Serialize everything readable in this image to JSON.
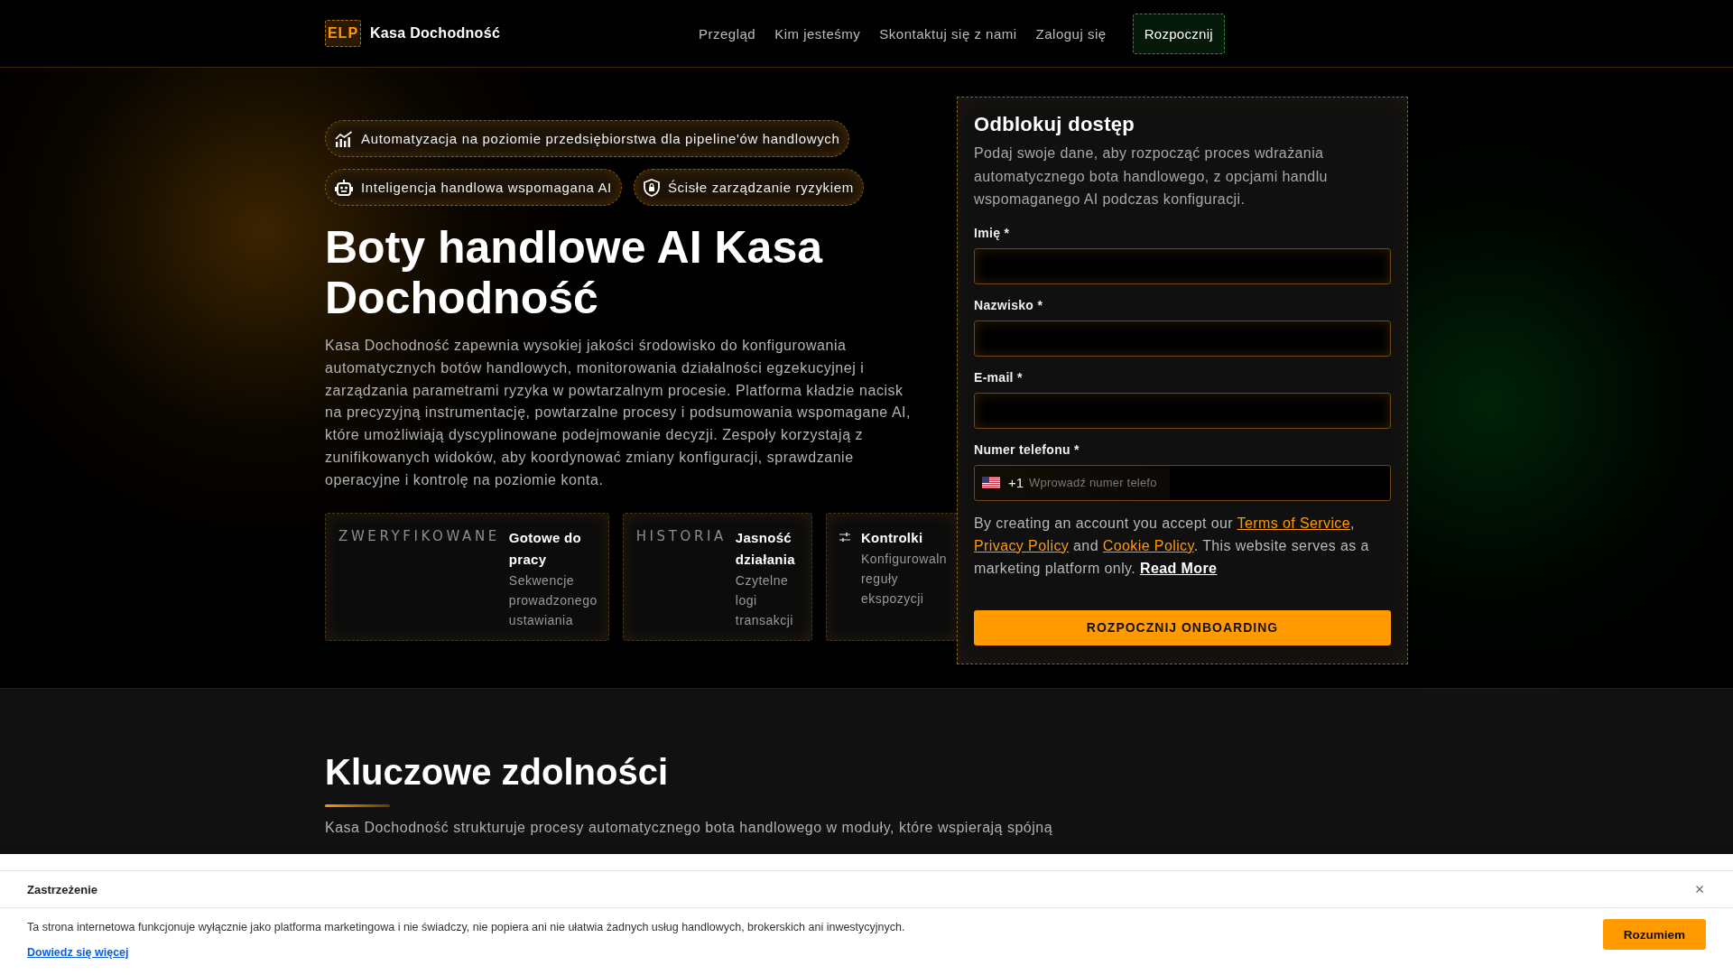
{
  "header": {
    "logo_mark": "ELP",
    "brand": "Kasa Dochodność",
    "nav": [
      "Przegląd",
      "Kim jesteśmy",
      "Skontaktuj się z nami",
      "Zaloguj się"
    ],
    "cta": "Rozpocznij"
  },
  "hero": {
    "badges": [
      {
        "kind": "chart",
        "label": "Automatyzacja na poziomie przedsiębiorstwa dla pipeline'ów handlowych"
      },
      {
        "kind": "robot",
        "label": "Inteligencja handlowa wspomagana AI"
      },
      {
        "kind": "shield",
        "label": "Ścisłe zarządzanie ryzykiem"
      }
    ],
    "title": "Boty handlowe AI Kasa Dochodność",
    "description": "Kasa Dochodność zapewnia wysokiej jakości środowisko do konfigurowania automatycznych botów handlowych, monitorowania działalności egzekucyjnej i zarządzania parametrami ryzyka w powtarzalnym procesie. Platforma kładzie nacisk na precyzyjną instrumentację, powtarzalne procesy i podsumowania wspomagane AI, które umożliwiają dyscyplinowane podejmowanie decyzji. Zespoły korzystają z zunifikowanych widoków, aby koordynować zmiany konfiguracji, sprawdzanie operacyjne i kontrolę na poziomie konta.",
    "cards": [
      {
        "kind": "tag",
        "tag": "ZWERYFIKOWANE",
        "title": "Gotowe do pracy",
        "text": "Sekwencje prowadzonego ustawiania"
      },
      {
        "kind": "tag",
        "tag": "HISTORIA",
        "title": "Jasność działania",
        "text": "Czytelne logi transakcji"
      },
      {
        "kind": "icon",
        "title": "Kontrolki",
        "text": "Konfigurowaln reguły ekspozycji"
      }
    ]
  },
  "signup_form": {
    "title": "Odblokuj dostęp",
    "description": "Podaj swoje dane, aby rozpocząć proces wdrażania automatycznego bota handlowego, z opcjami handlu wspomaganego AI podczas konfiguracji.",
    "fields": [
      {
        "kind": "text",
        "label": "Imię *"
      },
      {
        "kind": "text",
        "label": "Nazwisko *"
      },
      {
        "kind": "text",
        "label": "E-mail *"
      },
      {
        "kind": "phone",
        "label": "Numer telefonu *",
        "dial_code": "+1",
        "placeholder": "Wprowadź numer telefo"
      }
    ],
    "legal": [
      {
        "kind": "text",
        "text": "By creating an account you accept our "
      },
      {
        "kind": "link",
        "text": "Terms of Service"
      },
      {
        "kind": "text",
        "text": ", "
      },
      {
        "kind": "link",
        "text": "Privacy Policy"
      },
      {
        "kind": "text",
        "text": " and "
      },
      {
        "kind": "link",
        "text": "Cookie Policy"
      },
      {
        "kind": "text",
        "text": ". This website serves as a marketing platform only. "
      },
      {
        "kind": "strong_link",
        "text": "Read More"
      }
    ],
    "submit": "ROZPOCZNIJ ONBOARDING"
  },
  "capabilities": {
    "title": "Kluczowe zdolności",
    "description": "Kasa Dochodność strukturuje procesy automatycznego bota handlowego w moduły, które wspierają spójną"
  },
  "disclaimer": {
    "title": "Zastrzeżenie",
    "text": "Ta strona internetowa funkcjonuje wyłącznie jako platforma marketingowa i nie świadczy, nie popiera ani nie ułatwia żadnych usług handlowych, brokerskich ani inwestycyjnych.",
    "link": "Dowiedz się więcej",
    "button": "Rozumiem"
  }
}
